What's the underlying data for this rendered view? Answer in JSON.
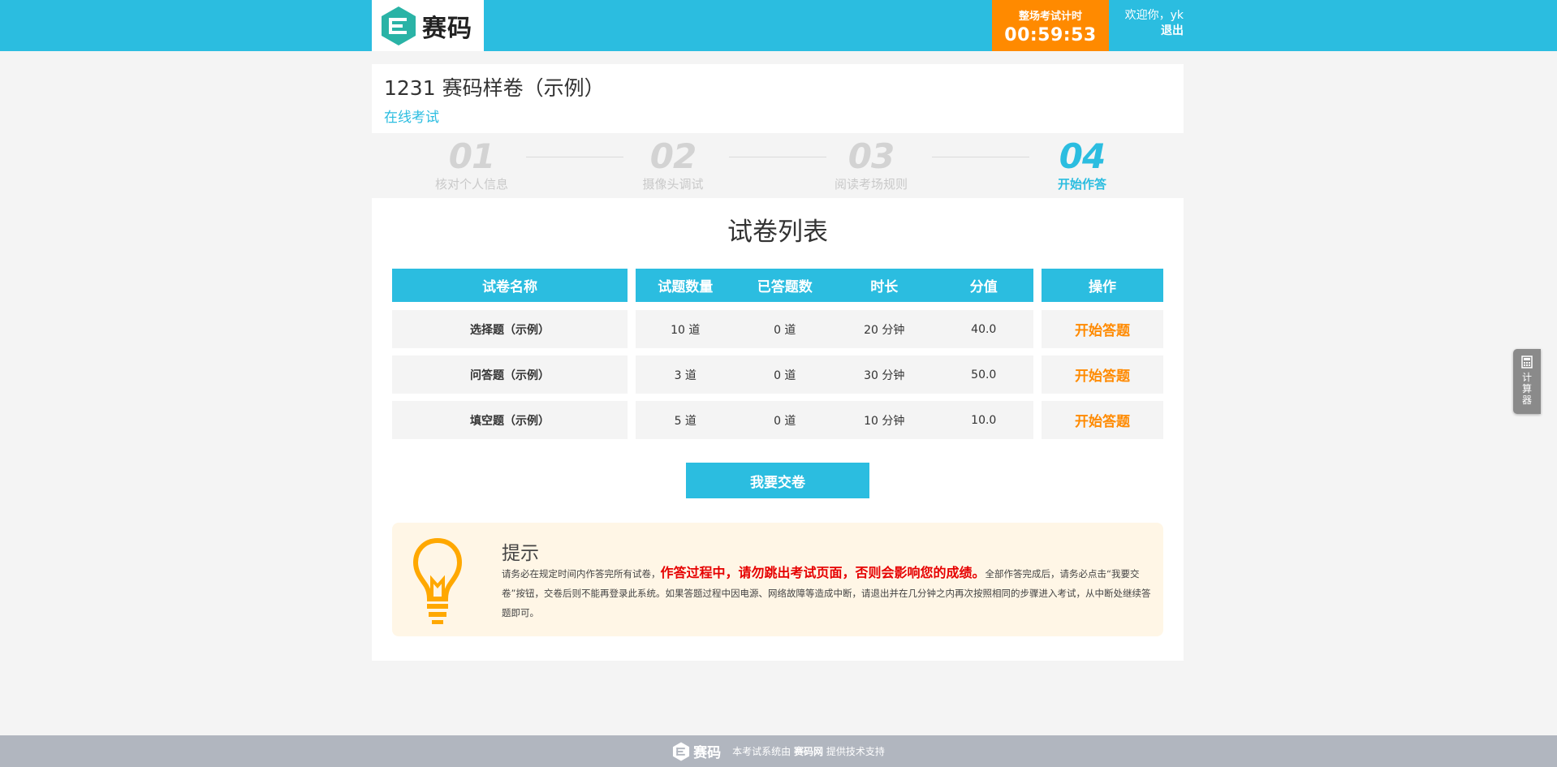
{
  "header": {
    "logo_text": "赛码",
    "timer_label": "整场考试计时",
    "timer_value": "00:59:53",
    "welcome": "欢迎你，yk",
    "logout": "退出"
  },
  "exam": {
    "title": "1231 赛码样卷（示例）",
    "subtitle": "在线考试"
  },
  "steps": [
    {
      "num": "01",
      "label": "核对个人信息",
      "active": false
    },
    {
      "num": "02",
      "label": "摄像头调试",
      "active": false
    },
    {
      "num": "03",
      "label": "阅读考场规则",
      "active": false
    },
    {
      "num": "04",
      "label": "开始作答",
      "active": true
    }
  ],
  "panel": {
    "title": "试卷列表",
    "columns": {
      "name": "试卷名称",
      "count": "试题数量",
      "answered": "已答题数",
      "duration": "时长",
      "score": "分值",
      "action": "操作"
    },
    "rows": [
      {
        "name": "选择题（示例）",
        "count": "10 道",
        "answered": "0 道",
        "duration": "20 分钟",
        "score": "40.0",
        "action": "开始答题"
      },
      {
        "name": "问答题（示例）",
        "count": "3 道",
        "answered": "0 道",
        "duration": "30 分钟",
        "score": "50.0",
        "action": "开始答题"
      },
      {
        "name": "填空题（示例）",
        "count": "5 道",
        "answered": "0 道",
        "duration": "10 分钟",
        "score": "10.0",
        "action": "开始答题"
      }
    ],
    "submit_label": "我要交卷"
  },
  "tip": {
    "title": "提示",
    "text_before": "请务必在规定时间内作答完所有试卷，",
    "text_warning": "作答过程中，请勿跳出考试页面，否则会影响您的成绩。",
    "text_after": "全部作答完成后，请务必点击“我要交卷”按钮，交卷后则不能再登录此系统。如果答题过程中因电源、网络故障等造成中断，请退出并在几分钟之内再次按照相同的步骤进入考试，从中断处继续答题即可。"
  },
  "calculator": {
    "label": "计算器",
    "chars": [
      "计",
      "算",
      "器"
    ]
  },
  "footer": {
    "logo_text": "赛码",
    "text_before": "本考试系统由",
    "brand": "赛码网",
    "text_after": "提供技术支持"
  },
  "colors": {
    "primary": "#2bbde0",
    "timer": "#ff8a00",
    "action": "#ff8a00",
    "warning": "#e60000",
    "tip_bg": "#fff6e6",
    "footer_bg": "#b1b6bf"
  }
}
